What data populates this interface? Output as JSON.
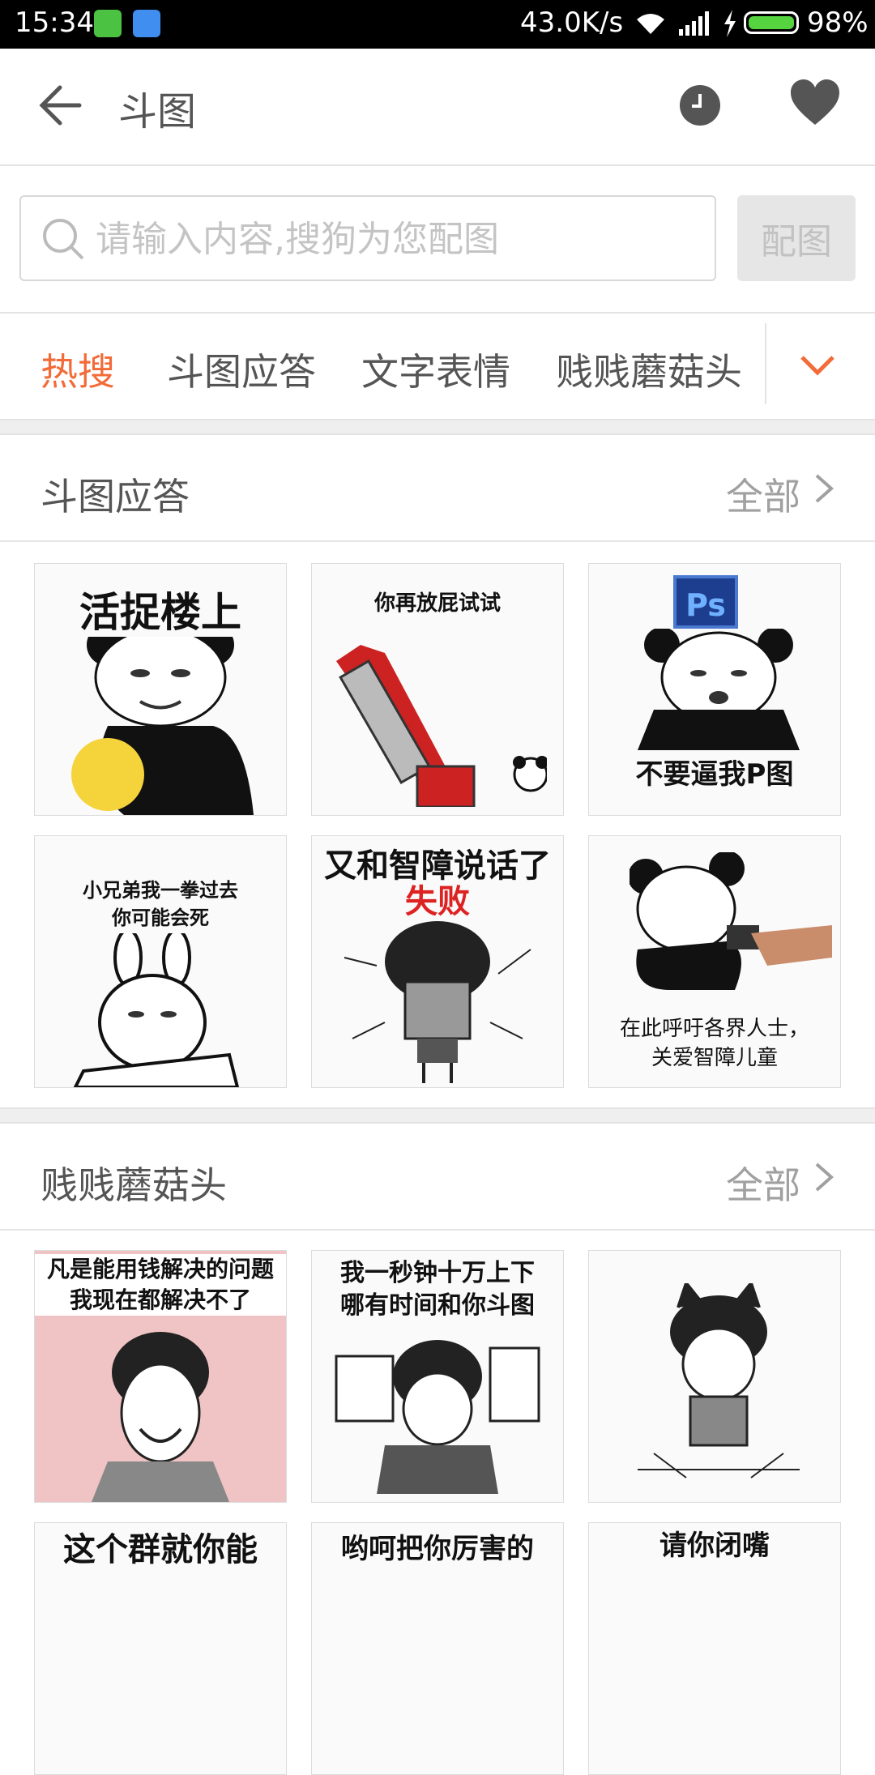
{
  "status_bar": {
    "time": "15:34",
    "speed": "43.0K/s",
    "battery": "98%"
  },
  "app_bar": {
    "title": "斗图"
  },
  "search": {
    "placeholder": "请输入内容,搜狗为您配图",
    "button": "配图"
  },
  "tabs": [
    {
      "label": "热搜",
      "active": true
    },
    {
      "label": "斗图应答",
      "active": false
    },
    {
      "label": "文字表情",
      "active": false
    },
    {
      "label": "贱贱蘑菇头",
      "active": false
    }
  ],
  "sections": [
    {
      "title": "斗图应答",
      "all_label": "全部",
      "items": [
        {
          "caption": "活捉楼上"
        },
        {
          "caption": "你再放屁试试"
        },
        {
          "caption": "不要逼我P图",
          "badge": "Ps"
        },
        {
          "caption": "小兄弟我一拳过去\n你可能会死"
        },
        {
          "caption": "又和智障说话了",
          "sub": "失败"
        },
        {
          "caption": "在此呼吁各界人士，\n关爱智障儿童"
        }
      ]
    },
    {
      "title": "贱贱蘑菇头",
      "all_label": "全部",
      "items": [
        {
          "caption": "凡是能用钱解决的问题\n我现在都解决不了"
        },
        {
          "caption": "我一秒钟十万上下\n哪有时间和你斗图"
        },
        {
          "caption": ""
        },
        {
          "caption": "这个群就你能"
        },
        {
          "caption": "哟呵把你厉害的"
        },
        {
          "caption": "请你闭嘴"
        }
      ]
    }
  ],
  "colors": {
    "accent": "#f26b38",
    "status_bar": "#000000"
  }
}
